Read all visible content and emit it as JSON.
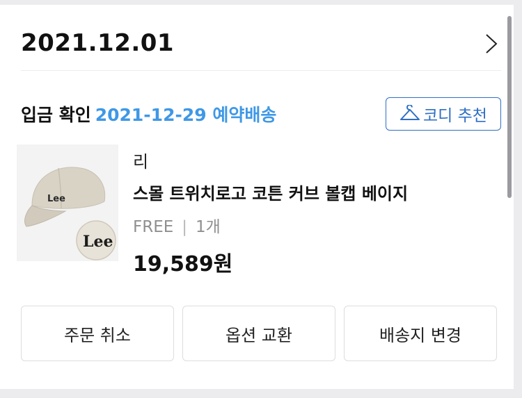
{
  "order": {
    "date": "2021.12.01"
  },
  "status": {
    "label": "입금 확인",
    "delivery": "2021-12-29 예약배송",
    "codi_button": "코디 추천"
  },
  "product": {
    "brand": "리",
    "name": "스몰 트위치로고 코튼 커브 볼캡 베이지",
    "option": "FREE",
    "separator": "|",
    "quantity": "1개",
    "price": "19,589원",
    "image_logo_text": "Lee"
  },
  "actions": {
    "cancel": "주문 취소",
    "exchange": "옵션 교환",
    "address": "배송지 변경"
  },
  "colors": {
    "accent_blue": "#3f98e6",
    "button_blue": "#2f6fc4"
  },
  "icons": {
    "chevron": "chevron-right-icon",
    "hanger": "hanger-icon"
  }
}
